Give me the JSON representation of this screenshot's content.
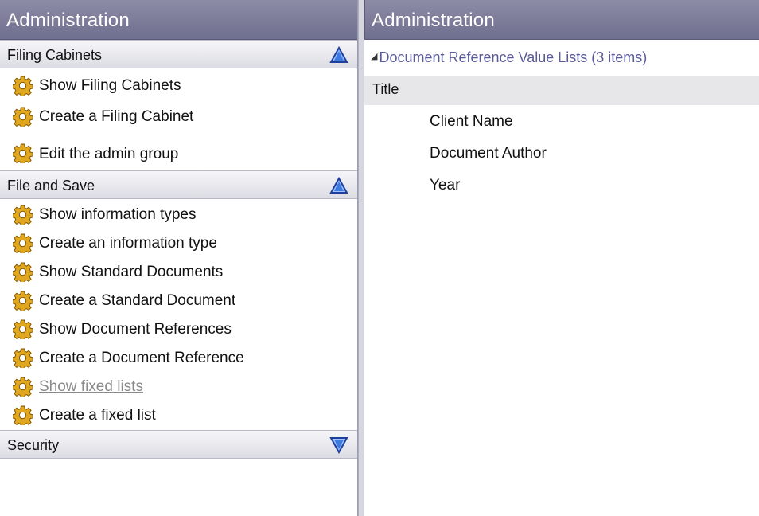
{
  "nav": {
    "title": "Administration",
    "groups": [
      {
        "label": "Filing Cabinets",
        "expanded": true,
        "tasks": [
          {
            "label": "Show Filing Cabinets",
            "icon": "gear-icon"
          },
          {
            "label": "Create a Filing Cabinet",
            "icon": "gear-icon"
          },
          {
            "label": "Edit the admin group",
            "icon": "gear-icon"
          }
        ]
      },
      {
        "label": "File and Save",
        "expanded": true,
        "tasks": [
          {
            "label": "Show information types",
            "icon": "gear-icon"
          },
          {
            "label": "Create an information type",
            "icon": "gear-icon"
          },
          {
            "label": "Show Standard Documents",
            "icon": "gear-icon"
          },
          {
            "label": "Create a Standard Document",
            "icon": "gear-icon"
          },
          {
            "label": "Show Document References",
            "icon": "gear-icon"
          },
          {
            "label": "Create a Document Reference",
            "icon": "gear-icon"
          },
          {
            "label": "Show fixed lists",
            "icon": "gear-icon",
            "state": "disabled"
          },
          {
            "label": "Create a fixed list",
            "icon": "gear-icon"
          }
        ]
      },
      {
        "label": "Security",
        "expanded": false,
        "tasks": []
      }
    ]
  },
  "content": {
    "title": "Administration",
    "list_caption": "Document Reference Value Lists (3 items)",
    "column_header": "Title",
    "rows": [
      "Client Name",
      "Document Author",
      "Year"
    ]
  },
  "colors": {
    "header_bg": "#7a7a98",
    "caption_text": "#5a5a9a",
    "chevron_blue": "#2f5fd0",
    "gear_gold": "#e0a820"
  }
}
